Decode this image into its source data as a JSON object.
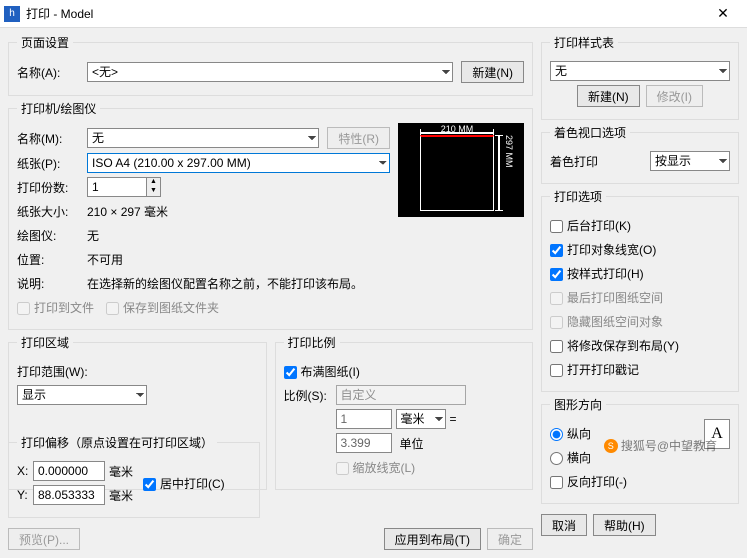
{
  "window": {
    "title": "打印 - Model",
    "close": "✕"
  },
  "page_setup": {
    "legend": "页面设置",
    "name_label": "名称(A):",
    "name_value": "<无>",
    "new_btn": "新建(N)"
  },
  "printer": {
    "legend": "打印机/绘图仪",
    "name_label": "名称(M):",
    "name_value": "无",
    "props_btn": "特性(R)",
    "paper_label": "纸张(P):",
    "paper_value": "ISO A4 (210.00 x 297.00 MM)",
    "copies_label": "打印份数:",
    "copies_value": "1",
    "size_label": "纸张大小:",
    "size_value": "210 × 297  毫米",
    "plotter_label": "绘图仪:",
    "plotter_value": "无",
    "loc_label": "位置:",
    "loc_value": "不可用",
    "desc_label": "说明:",
    "desc_value": "在选择新的绘图仪配置名称之前，不能打印该布局。",
    "to_file": "打印到文件",
    "save_folder": "保存到图纸文件夹",
    "preview_w": "210 MM",
    "preview_h": "297 MM"
  },
  "area": {
    "legend": "打印区域",
    "range_label": "打印范围(W):",
    "range_value": "显示"
  },
  "scale": {
    "legend": "打印比例",
    "fit": "布满图纸(I)",
    "ratio_label": "比例(S):",
    "ratio_value": "自定义",
    "num": "1",
    "unit_sel": "毫米",
    "eq": "=",
    "den": "3.399",
    "unit2": "单位",
    "lw": "缩放线宽(L)"
  },
  "offset": {
    "legend": "打印偏移（原点设置在可打印区域）",
    "x_label": "X:",
    "x_value": "0.000000",
    "unit": "毫米",
    "y_label": "Y:",
    "y_value": "88.053333",
    "center": "居中打印(C)"
  },
  "style": {
    "legend": "打印样式表",
    "value": "无",
    "new_btn": "新建(N)",
    "edit_btn": "修改(I)"
  },
  "viewport": {
    "legend": "着色视口选项",
    "label": "着色打印",
    "value": "按显示"
  },
  "options": {
    "legend": "打印选项",
    "bg": "后台打印(K)",
    "lw": "打印对象线宽(O)",
    "style": "按样式打印(H)",
    "paper_last": "最后打印图纸空间",
    "hide": "隐藏图纸空间对象",
    "save_layout": "将修改保存到布局(Y)",
    "stamp": "打开打印戳记"
  },
  "orient": {
    "legend": "图形方向",
    "portrait": "纵向",
    "landscape": "横向",
    "reverse": "反向打印(-)",
    "icon": "A"
  },
  "footer": {
    "preview": "预览(P)...",
    "apply": "应用到布局(T)",
    "ok": "确定",
    "cancel": "取消",
    "help": "帮助(H)"
  },
  "watermark": "搜狐号@中望教育"
}
